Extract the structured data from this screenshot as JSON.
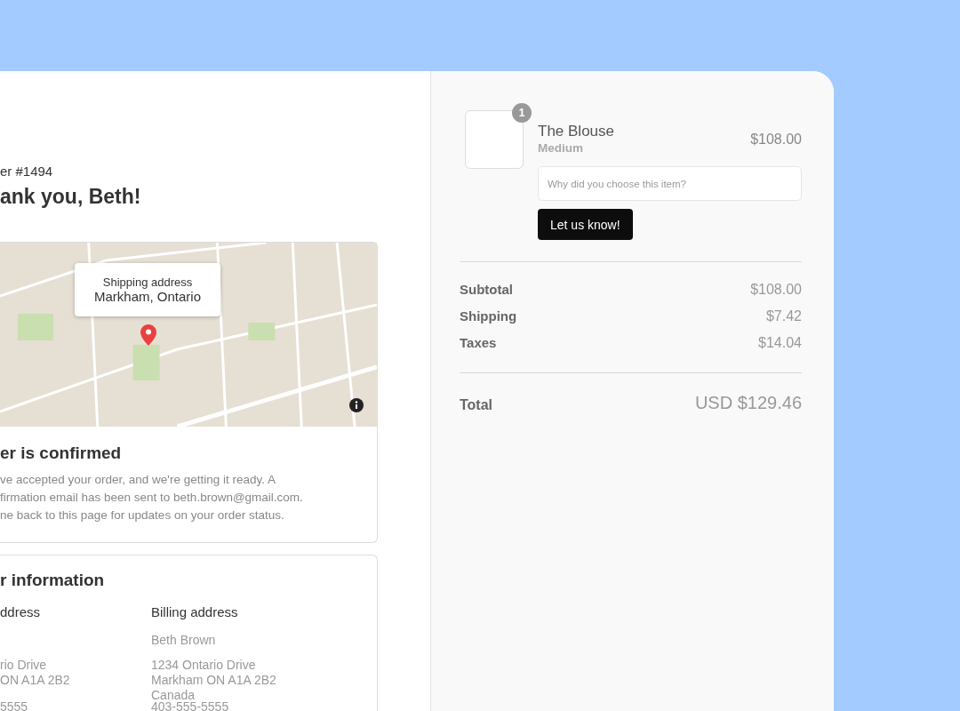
{
  "order": {
    "number": "er #1494",
    "greeting": "ank you, Beth!"
  },
  "map": {
    "popup_title": "Shipping address",
    "popup_place": "Markham, Ontario"
  },
  "confirmation": {
    "title": "er is confirmed",
    "lines": [
      "ve accepted your order, and we're getting it ready. A",
      "firmation email has been sent to beth.brown@gmail.com.",
      "ne back to this page for updates on your order status."
    ]
  },
  "customer_info": {
    "title": "r information",
    "shipping": {
      "heading": "ddress",
      "address_lines": [
        "rio Drive",
        "ON A1A 2B2"
      ],
      "phone": "5555"
    },
    "billing": {
      "heading": "Billing address",
      "name": "Beth Brown",
      "address_lines": [
        "1234 Ontario Drive",
        "Markham ON A1A 2B2",
        "Canada"
      ],
      "phone": "403-555-5555"
    }
  },
  "cart": {
    "items": [
      {
        "quantity": "1",
        "name": "The Blouse",
        "variant": "Medium",
        "price": "$108.00",
        "feedback": {
          "placeholder": "Why did you choose this item?"
        },
        "button": "Let us know!"
      }
    ],
    "summary": [
      {
        "label": "Subtotal",
        "value": "$108.00"
      },
      {
        "label": "Shipping",
        "value": "$7.42"
      },
      {
        "label": "Taxes",
        "value": "$14.04"
      }
    ],
    "total": {
      "label": "Total",
      "value": "USD $129.46"
    }
  }
}
